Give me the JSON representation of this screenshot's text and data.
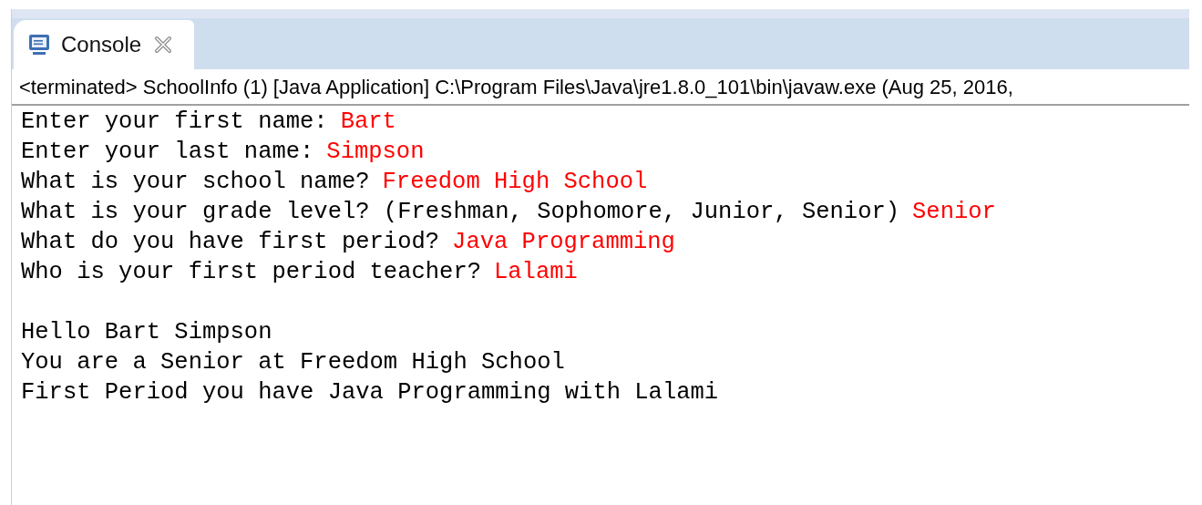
{
  "tab": {
    "label": "Console",
    "selected": true
  },
  "process_label": "<terminated> SchoolInfo (1) [Java Application] C:\\Program Files\\Java\\jre1.8.0_101\\bin\\javaw.exe (Aug 25, 2016,",
  "console_lines": [
    {
      "kind": "text",
      "segments": [
        {
          "kind": "output",
          "text": "Enter your first name:"
        },
        {
          "kind": "input",
          "text": "Bart"
        }
      ]
    },
    {
      "kind": "text",
      "segments": [
        {
          "kind": "output",
          "text": "Enter your last name:"
        },
        {
          "kind": "input",
          "text": "Simpson"
        }
      ]
    },
    {
      "kind": "text",
      "segments": [
        {
          "kind": "output",
          "text": "What is your school name?"
        },
        {
          "kind": "input",
          "text": "Freedom High School"
        }
      ]
    },
    {
      "kind": "text",
      "segments": [
        {
          "kind": "output",
          "text": "What is your grade level? (Freshman, Sophomore, Junior, Senior)"
        },
        {
          "kind": "input",
          "text": "Senior"
        }
      ]
    },
    {
      "kind": "text",
      "segments": [
        {
          "kind": "output",
          "text": "What do you have first period?"
        },
        {
          "kind": "input",
          "text": "Java Programming"
        }
      ]
    },
    {
      "kind": "text",
      "segments": [
        {
          "kind": "output",
          "text": "Who is your first period teacher?"
        },
        {
          "kind": "input",
          "text": "Lalami"
        }
      ]
    },
    {
      "kind": "blank"
    },
    {
      "kind": "text",
      "segments": [
        {
          "kind": "output",
          "text": "Hello Bart Simpson"
        }
      ]
    },
    {
      "kind": "text",
      "segments": [
        {
          "kind": "output",
          "text": "You are a Senior at Freedom High School"
        }
      ]
    },
    {
      "kind": "text",
      "segments": [
        {
          "kind": "output",
          "text": "First Period you have Java Programming with Lalami"
        }
      ]
    }
  ]
}
